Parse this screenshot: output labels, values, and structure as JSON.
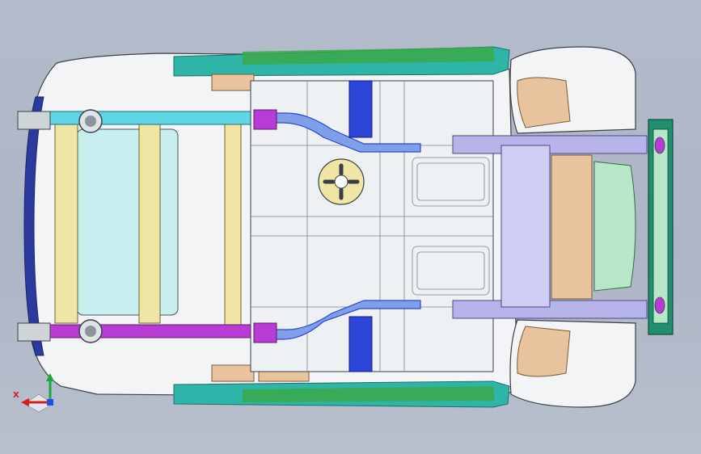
{
  "viewport": {
    "background_top": "#b4bccb",
    "background_bottom": "#b8bfcc"
  },
  "model": {
    "description_colors": {
      "body_white": "#f4f6f8",
      "body_outline": "#3a3f47",
      "teal_rail": "#2fb5a8",
      "green_rail": "#3aa84a",
      "cyan_crossmember": "#5fd6e6",
      "purple_crossmember": "#b93bd6",
      "blue_bracket": "#2b45d8",
      "lavender_frame": "#b7b4ea",
      "yellow_panel": "#efe6a6",
      "peach_wheelhouse": "#e9c39e",
      "mint_rear_panel": "#b8e6c8",
      "rear_frame_green": "#1f8f6e"
    }
  },
  "triad": {
    "x_label": "X",
    "x_color": "#d81c1c",
    "y_color": "#2050e0",
    "z_color": "#1aa83a"
  }
}
